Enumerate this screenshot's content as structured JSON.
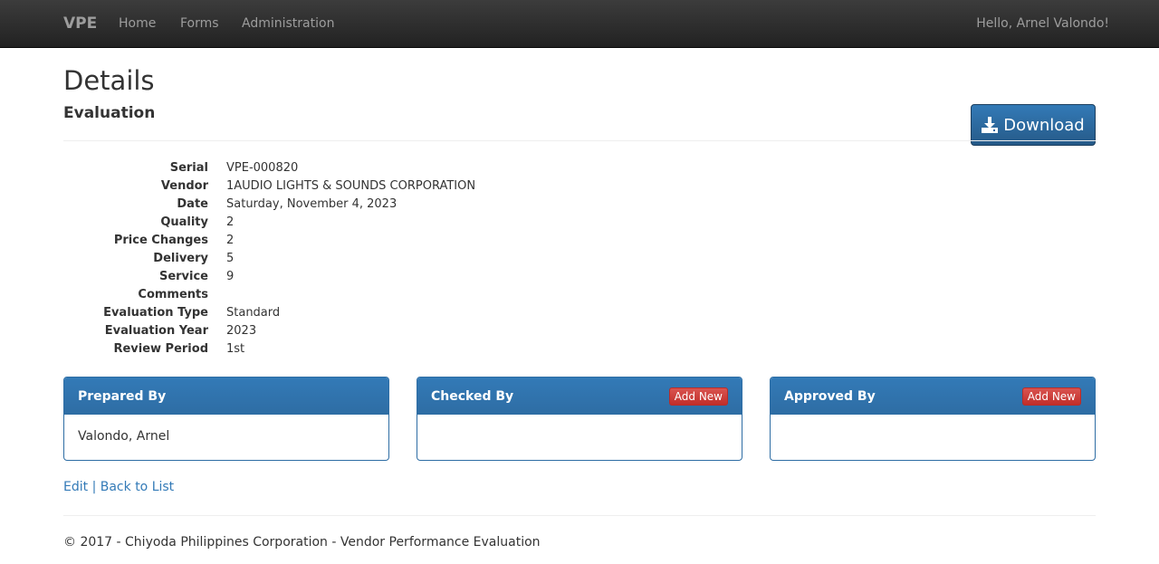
{
  "navbar": {
    "brand": "VPE",
    "items": [
      {
        "label": "Home"
      },
      {
        "label": "Forms"
      },
      {
        "label": "Administration"
      }
    ],
    "user_greeting": "Hello, Arnel Valondo!"
  },
  "page": {
    "title": "Details",
    "subtitle": "Evaluation",
    "download_label": "Download"
  },
  "details": [
    {
      "label": "Serial",
      "value": "VPE-000820"
    },
    {
      "label": "Vendor",
      "value": "1AUDIO LIGHTS & SOUNDS CORPORATION"
    },
    {
      "label": "Date",
      "value": "Saturday, November 4, 2023"
    },
    {
      "label": "Quality",
      "value": "2"
    },
    {
      "label": "Price Changes",
      "value": "2"
    },
    {
      "label": "Delivery",
      "value": "5"
    },
    {
      "label": "Service",
      "value": "9"
    },
    {
      "label": "Comments",
      "value": ""
    },
    {
      "label": "Evaluation Type",
      "value": "Standard"
    },
    {
      "label": "Evaluation Year",
      "value": "2023"
    },
    {
      "label": "Review Period",
      "value": "1st"
    }
  ],
  "panels": {
    "prepared": {
      "title": "Prepared By",
      "body": "Valondo, Arnel"
    },
    "checked": {
      "title": "Checked By",
      "button": "Add New",
      "body": ""
    },
    "approved": {
      "title": "Approved By",
      "button": "Add New",
      "body": ""
    }
  },
  "links": {
    "edit": "Edit",
    "separator": "|",
    "back": "Back to List"
  },
  "footer": {
    "text": "© 2017 - Chiyoda Philippines Corporation - Vendor Performance Evaluation"
  },
  "colors": {
    "primary": "#337ab7",
    "danger": "#d9534f",
    "navbar": "#222222"
  }
}
